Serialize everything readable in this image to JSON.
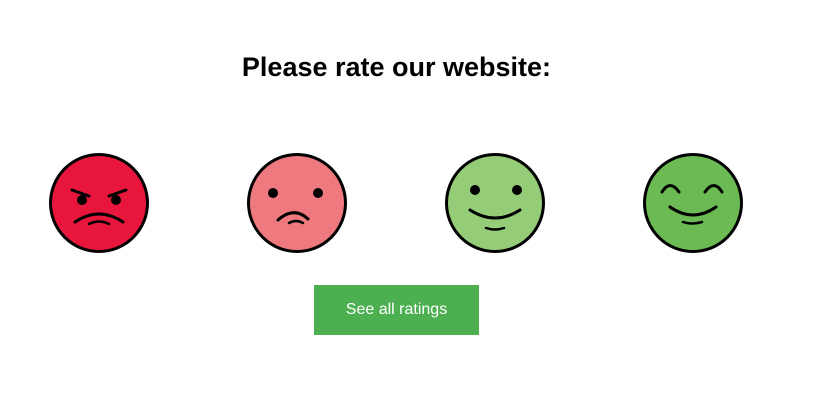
{
  "page": {
    "title": "Please rate our website:"
  },
  "ratings": [
    {
      "icon": "angry-face-icon",
      "color": "#e8163c"
    },
    {
      "icon": "sad-face-icon",
      "color": "#ee7a80"
    },
    {
      "icon": "smiling-face-icon",
      "color": "#94cc78"
    },
    {
      "icon": "happy-face-icon",
      "color": "#6cba54"
    }
  ],
  "button": {
    "label": "See all ratings",
    "color": "#4caf50"
  }
}
